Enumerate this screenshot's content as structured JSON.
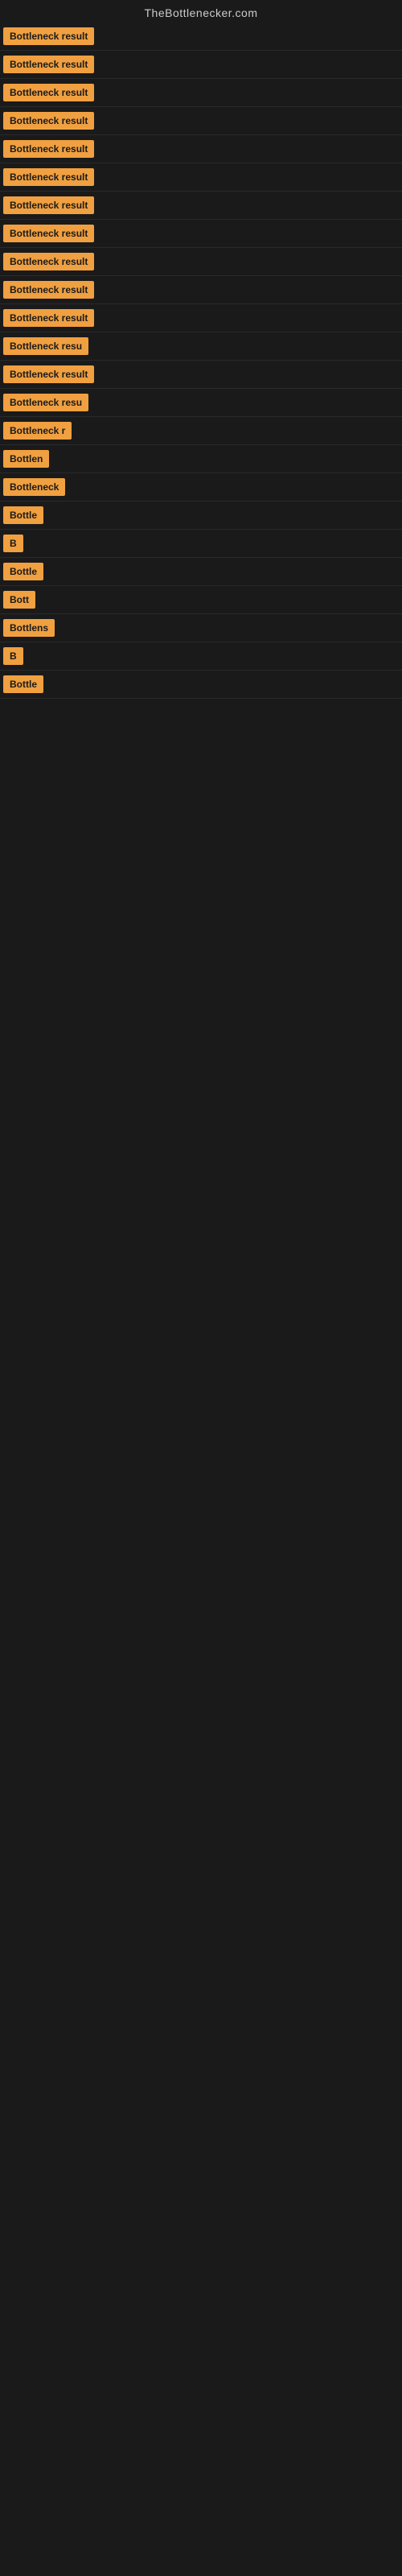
{
  "site": {
    "title": "TheBottlenecker.com"
  },
  "rows": [
    {
      "id": 1,
      "label": "Bottleneck result",
      "truncated": false
    },
    {
      "id": 2,
      "label": "Bottleneck result",
      "truncated": false
    },
    {
      "id": 3,
      "label": "Bottleneck result",
      "truncated": false
    },
    {
      "id": 4,
      "label": "Bottleneck result",
      "truncated": false
    },
    {
      "id": 5,
      "label": "Bottleneck result",
      "truncated": false
    },
    {
      "id": 6,
      "label": "Bottleneck result",
      "truncated": false
    },
    {
      "id": 7,
      "label": "Bottleneck result",
      "truncated": false
    },
    {
      "id": 8,
      "label": "Bottleneck result",
      "truncated": false
    },
    {
      "id": 9,
      "label": "Bottleneck result",
      "truncated": false
    },
    {
      "id": 10,
      "label": "Bottleneck result",
      "truncated": false
    },
    {
      "id": 11,
      "label": "Bottleneck result",
      "truncated": false
    },
    {
      "id": 12,
      "label": "Bottleneck resu",
      "truncated": true
    },
    {
      "id": 13,
      "label": "Bottleneck result",
      "truncated": false
    },
    {
      "id": 14,
      "label": "Bottleneck resu",
      "truncated": true
    },
    {
      "id": 15,
      "label": "Bottleneck r",
      "truncated": true
    },
    {
      "id": 16,
      "label": "Bottlen",
      "truncated": true
    },
    {
      "id": 17,
      "label": "Bottleneck",
      "truncated": true
    },
    {
      "id": 18,
      "label": "Bottle",
      "truncated": true
    },
    {
      "id": 19,
      "label": "B",
      "truncated": true
    },
    {
      "id": 20,
      "label": "Bottle",
      "truncated": true
    },
    {
      "id": 21,
      "label": "Bott",
      "truncated": true
    },
    {
      "id": 22,
      "label": "Bottlens",
      "truncated": true
    },
    {
      "id": 23,
      "label": "B",
      "truncated": true
    },
    {
      "id": 24,
      "label": "Bottle",
      "truncated": true
    }
  ]
}
